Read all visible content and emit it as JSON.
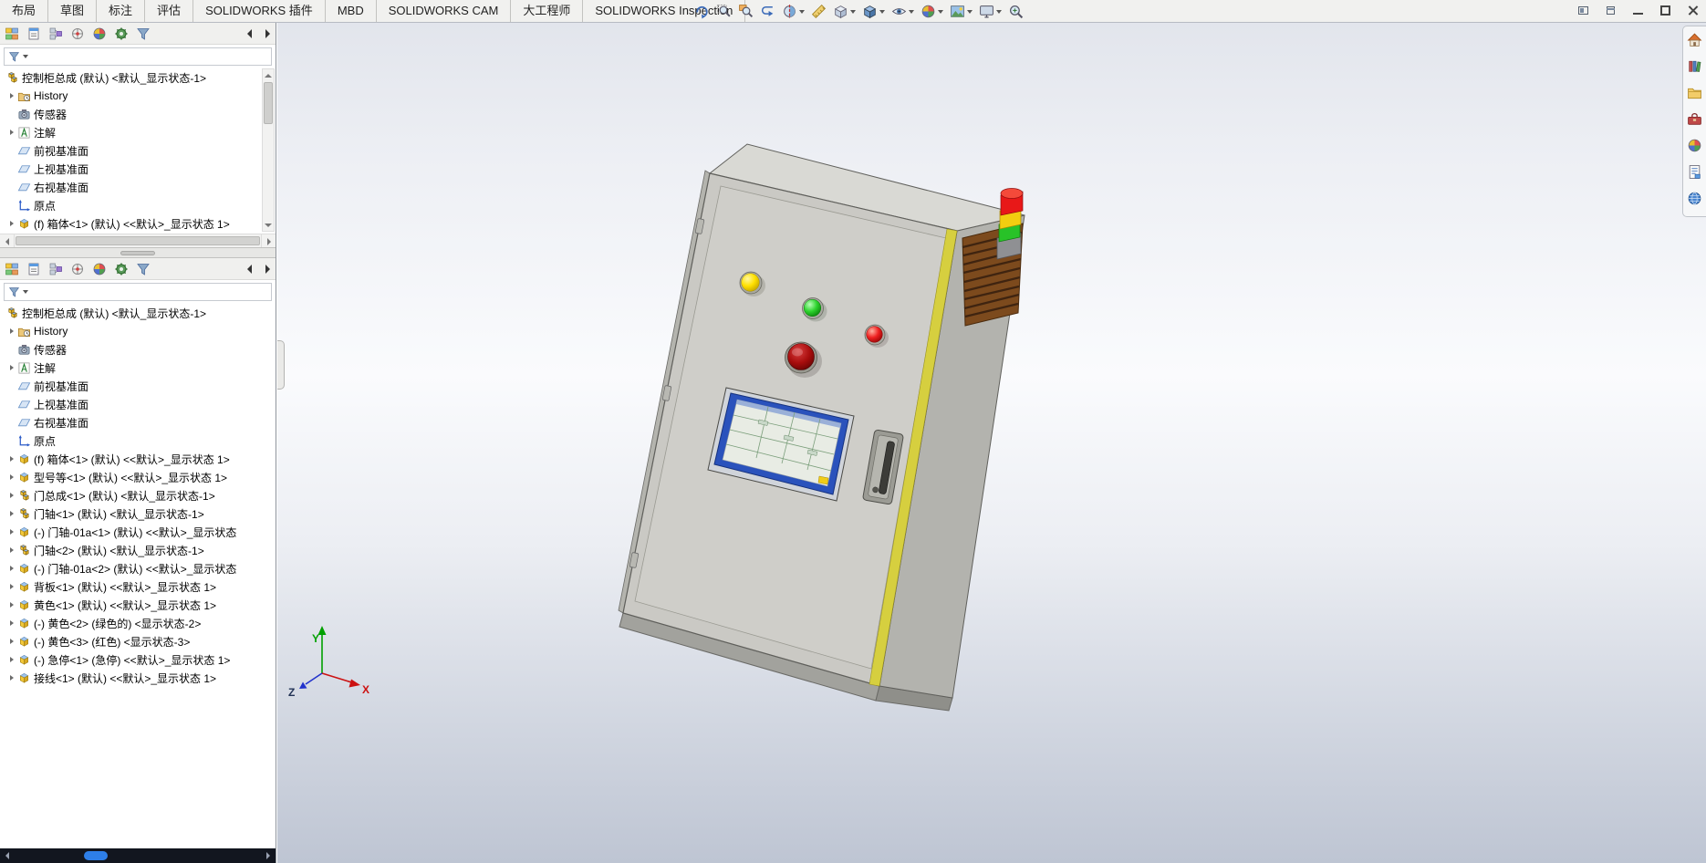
{
  "menu": {
    "tabs": [
      "布局",
      "草图",
      "标注",
      "评估",
      "SOLIDWORKS 插件",
      "MBD",
      "SOLIDWORKS CAM",
      "大工程师",
      "SOLIDWORKS Inspection"
    ]
  },
  "hud": {
    "icons": [
      {
        "icon": "apply-view"
      },
      {
        "icon": "zoom-fit"
      },
      {
        "icon": "zoom-area"
      },
      {
        "icon": "previous-view"
      },
      {
        "icon": "section-view",
        "caret": true
      },
      {
        "icon": "measure"
      },
      {
        "icon": "view-orientation",
        "caret": true
      },
      {
        "icon": "display-style",
        "caret": true
      },
      {
        "icon": "hide-show",
        "caret": true
      },
      {
        "icon": "edit-appearance",
        "caret": true
      },
      {
        "icon": "apply-scene",
        "caret": true
      },
      {
        "icon": "view-settings",
        "caret": true
      },
      {
        "icon": "magnifier"
      }
    ]
  },
  "window": {
    "controls": [
      "window-pane",
      "window-grid",
      "minimize",
      "maximize",
      "close"
    ]
  },
  "panels": {
    "toolbar_icons": [
      {
        "icon": "featuremanager"
      },
      {
        "icon": "propertymanager"
      },
      {
        "icon": "configurationmanager"
      },
      {
        "icon": "dimxpertmanager"
      },
      {
        "icon": "displaymanager"
      },
      {
        "icon": "cam"
      },
      {
        "icon": "inspection"
      }
    ],
    "filter_value": ""
  },
  "tree1": {
    "root": {
      "icon": "assembly",
      "label": "控制柜总成 (默认) <默认_显示状态-1>"
    },
    "items": [
      {
        "icon": "history",
        "expand": true,
        "label": "History"
      },
      {
        "icon": "sensor",
        "expand": false,
        "label": "传感器"
      },
      {
        "icon": "annotation",
        "expand": true,
        "label": "注解"
      },
      {
        "icon": "plane",
        "expand": false,
        "label": "前视基准面"
      },
      {
        "icon": "plane",
        "expand": false,
        "label": "上视基准面"
      },
      {
        "icon": "plane",
        "expand": false,
        "label": "右视基准面"
      },
      {
        "icon": "origin",
        "expand": false,
        "label": "原点"
      },
      {
        "icon": "part",
        "expand": true,
        "label": "(f) 箱体<1> (默认) <<默认>_显示状态 1>"
      }
    ]
  },
  "tree2": {
    "root": {
      "icon": "assembly",
      "label": "控制柜总成 (默认) <默认_显示状态-1>"
    },
    "items": [
      {
        "icon": "history",
        "expand": true,
        "label": "History"
      },
      {
        "icon": "sensor",
        "expand": false,
        "label": "传感器"
      },
      {
        "icon": "annotation",
        "expand": true,
        "label": "注解"
      },
      {
        "icon": "plane",
        "expand": false,
        "label": "前视基准面"
      },
      {
        "icon": "plane",
        "expand": false,
        "label": "上视基准面"
      },
      {
        "icon": "plane",
        "expand": false,
        "label": "右视基准面"
      },
      {
        "icon": "origin",
        "expand": false,
        "label": "原点"
      },
      {
        "icon": "part",
        "expand": true,
        "label": "(f) 箱体<1> (默认) <<默认>_显示状态 1>"
      },
      {
        "icon": "part",
        "expand": true,
        "label": "型号等<1> (默认) <<默认>_显示状态 1>"
      },
      {
        "icon": "assembly",
        "expand": true,
        "label": "门总成<1> (默认) <默认_显示状态-1>"
      },
      {
        "icon": "assembly",
        "expand": true,
        "label": "门轴<1> (默认) <默认_显示状态-1>"
      },
      {
        "icon": "part",
        "expand": true,
        "label": "(-) 门轴-01a<1> (默认) <<默认>_显示状态"
      },
      {
        "icon": "assembly",
        "expand": true,
        "label": "门轴<2> (默认) <默认_显示状态-1>"
      },
      {
        "icon": "part",
        "expand": true,
        "label": "(-) 门轴-01a<2> (默认) <<默认>_显示状态"
      },
      {
        "icon": "part",
        "expand": true,
        "label": "背板<1> (默认) <<默认>_显示状态 1>"
      },
      {
        "icon": "part",
        "expand": true,
        "label": "黄色<1> (默认) <<默认>_显示状态 1>"
      },
      {
        "icon": "part",
        "expand": true,
        "label": "(-) 黄色<2> (绿色的) <显示状态-2>"
      },
      {
        "icon": "part",
        "expand": true,
        "label": "(-) 黄色<3> (红色) <显示状态-3>"
      },
      {
        "icon": "part",
        "expand": true,
        "label": "(-) 急停<1> (急停) <<默认>_显示状态 1>"
      },
      {
        "icon": "part",
        "expand": true,
        "label": "接线<1> (默认) <<默认>_显示状态 1>"
      }
    ]
  },
  "taskpane": {
    "icons": [
      {
        "icon": "home"
      },
      {
        "icon": "design-library"
      },
      {
        "icon": "file-explorer"
      },
      {
        "icon": "toolbox"
      },
      {
        "icon": "appearances"
      },
      {
        "icon": "custom-properties"
      },
      {
        "icon": "3d-content"
      }
    ]
  },
  "viewport": {
    "model": "控制柜总成",
    "triad": {
      "x_label": "X",
      "y_label": "Y",
      "z_label": "Z"
    },
    "colors": {
      "cabinet_body": "#cac9c4",
      "cabinet_side": "#b3b3ae",
      "gasket": "#d6cf3f",
      "vent": "#7c4a1d",
      "button_yellow": "#ffe000",
      "button_green": "#2ed32e",
      "button_red": "#ee2020",
      "estop_red": "#a80d0d",
      "screen_frame": "#2a52bc",
      "tower_red": "#e81818",
      "tower_yellow": "#f2ce10",
      "tower_green": "#28c228"
    }
  }
}
